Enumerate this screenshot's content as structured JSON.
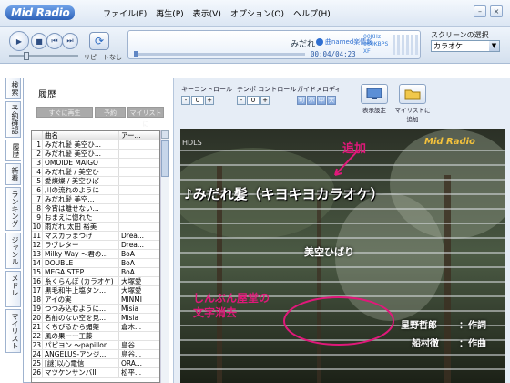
{
  "app": {
    "logo": "Mid Radio"
  },
  "menu": [
    "ファイル(F)",
    "再生(P)",
    "表示(V)",
    "オプション(O)",
    "ヘルプ(H)"
  ],
  "player": {
    "repeat_label": "リピートなし",
    "now_playing_title": "みだれ",
    "now_playing_badge": "曲named楽情報",
    "sample_rate": "00KHz",
    "bitrate": "000KBPS",
    "format": "XF",
    "time": "00:04/04:23"
  },
  "screen_select": {
    "label": "スクリーンの選択",
    "value": "カラオケ"
  },
  "side_tabs": [
    "検索",
    "予約確認",
    "履歴",
    "新着",
    "ランキング",
    "ジャンル",
    "メドレー",
    "マイリスト"
  ],
  "history": {
    "title": "履歴",
    "buttons": [
      "すぐに再生",
      "予約",
      "マイリストに"
    ],
    "columns": [
      "曲名",
      "アー..."
    ],
    "rows": [
      [
        "1",
        "みだれ髪 美空ひ...",
        ""
      ],
      [
        "2",
        "みだれ髪 美空ひ...",
        ""
      ],
      [
        "3",
        "OMOIDE MAIGO",
        ""
      ],
      [
        "4",
        "みだれ髪 / 美空ひ",
        ""
      ],
      [
        "5",
        "愛燦燦 / 美空ひば",
        ""
      ],
      [
        "6",
        "川の流れのように",
        ""
      ],
      [
        "7",
        "みだれ髪 美空...",
        ""
      ],
      [
        "8",
        "今宵は離せない...",
        ""
      ],
      [
        "9",
        "おまえに惚れた",
        ""
      ],
      [
        "10",
        "雨だれ 太田 裕美",
        ""
      ],
      [
        "11",
        "マスカラまつげ",
        "Drea..."
      ],
      [
        "12",
        "ラヴレター",
        "Drea..."
      ],
      [
        "13",
        "Milky Way ～君の...",
        "BoA"
      ],
      [
        "14",
        "DOUBLE",
        "BoA"
      ],
      [
        "15",
        "MEGA STEP",
        "BoA"
      ],
      [
        "16",
        "糸くらんぼ (カラオケ)",
        "大塚愛"
      ],
      [
        "17",
        "黒毛和牛上塩タン...",
        "大塚愛"
      ],
      [
        "18",
        "アイの実",
        "MINMI"
      ],
      [
        "19",
        "つつみ込むように...",
        "Misia"
      ],
      [
        "20",
        "名前のない空を見...",
        "Misia"
      ],
      [
        "21",
        "くちびるから媚薬",
        "倉木..."
      ],
      [
        "22",
        "風の果ーー工藤",
        ""
      ],
      [
        "23",
        "パピヨン ～papillon...",
        "島谷..."
      ],
      [
        "24",
        "ANGELUS-アンジ...",
        "島谷..."
      ],
      [
        "25",
        "[謎]以心電信",
        "ORA..."
      ],
      [
        "26",
        "マツケンサンバII",
        "松平..."
      ]
    ]
  },
  "controls": {
    "key": {
      "label": "キーコントロール",
      "value": "0"
    },
    "tempo": {
      "label": "テンポ コントロール",
      "value": "0"
    },
    "guide": {
      "label": "ガイドメロディ",
      "options": [
        "切",
        "小",
        "中",
        "大"
      ]
    },
    "display_settings": "表示設定",
    "add_mylist": "マイリストに追加"
  },
  "video": {
    "corner_tag": "HDLS",
    "logo": "Mid Radio",
    "annotation_top": "追加",
    "song_title": "♪みだれ髪（キヨキヨカラオケ）",
    "artist": "美空ひばり",
    "annotation_bottom_line1": "しんぶん屋堂の",
    "annotation_bottom_line2": "文字消去",
    "credit1_name": "星野哲郎",
    "credit1_role": "：作詞",
    "credit2_name": "船村徹",
    "credit2_role": "：作曲"
  },
  "colors": {
    "accent": "#2e62b8",
    "annotation": "#e0187a"
  }
}
